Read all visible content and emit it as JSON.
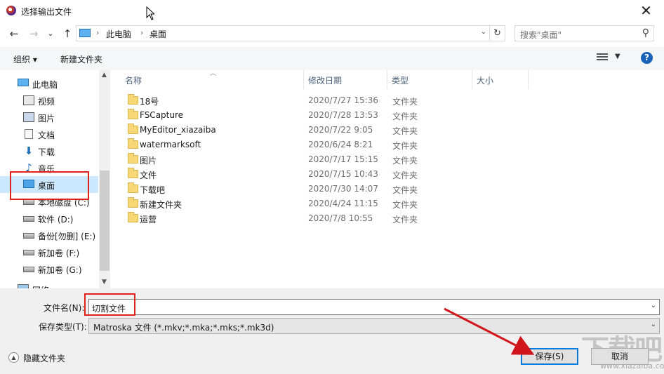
{
  "window": {
    "title": "选择输出文件",
    "close": "✕"
  },
  "nav": {
    "back": "←",
    "forward": "→",
    "recent": "⌄",
    "up": "↑"
  },
  "address": {
    "crumbs": [
      "此电脑",
      "桌面"
    ],
    "refresh": "↻"
  },
  "search": {
    "placeholder": "搜索\"桌面\""
  },
  "toolbar": {
    "organize": "组织 ▾",
    "new_folder": "新建文件夹",
    "help": "?"
  },
  "sidebar": {
    "items": [
      {
        "label": "此电脑"
      },
      {
        "label": "视频"
      },
      {
        "label": "图片"
      },
      {
        "label": "文档"
      },
      {
        "label": "下载"
      },
      {
        "label": "音乐"
      },
      {
        "label": "桌面"
      },
      {
        "label": "本地磁盘 (C:)"
      },
      {
        "label": "软件 (D:)"
      },
      {
        "label": "备份[勿删] (E:)"
      },
      {
        "label": "新加卷 (F:)"
      },
      {
        "label": "新加卷 (G:)"
      },
      {
        "label": "网络"
      }
    ]
  },
  "columns": {
    "name": "名称",
    "date": "修改日期",
    "type": "类型",
    "size": "大小"
  },
  "files": [
    {
      "name": "18号",
      "date": "2020/7/27 15:36",
      "type": "文件夹"
    },
    {
      "name": "FSCapture",
      "date": "2020/7/28 13:53",
      "type": "文件夹"
    },
    {
      "name": "MyEditor_xiazaiba",
      "date": "2020/7/22 9:05",
      "type": "文件夹"
    },
    {
      "name": "watermarksoft",
      "date": "2020/6/24 8:21",
      "type": "文件夹"
    },
    {
      "name": "图片",
      "date": "2020/7/17 15:15",
      "type": "文件夹"
    },
    {
      "name": "文件",
      "date": "2020/7/15 10:43",
      "type": "文件夹"
    },
    {
      "name": "下载吧",
      "date": "2020/7/30 14:07",
      "type": "文件夹"
    },
    {
      "name": "新建文件夹",
      "date": "2020/4/24 11:15",
      "type": "文件夹"
    },
    {
      "name": "运营",
      "date": "2020/7/8 10:55",
      "type": "文件夹"
    }
  ],
  "form": {
    "filename_label": "文件名(N):",
    "filename_value": "切割文件",
    "type_label": "保存类型(T):",
    "type_value": "Matroska 文件 (*.mkv;*.mka;*.mks;*.mk3d)"
  },
  "footer": {
    "hide_folders": "隐藏文件夹",
    "save": "保存(S)",
    "cancel": "取消"
  },
  "watermark": {
    "text": "下载吧",
    "sub": "www.xiazaiba.com"
  },
  "colors": {
    "selection": "#cce8ff",
    "highlight_box": "#e0221c",
    "arrow": "#d0161a",
    "accent": "#0078d7"
  }
}
